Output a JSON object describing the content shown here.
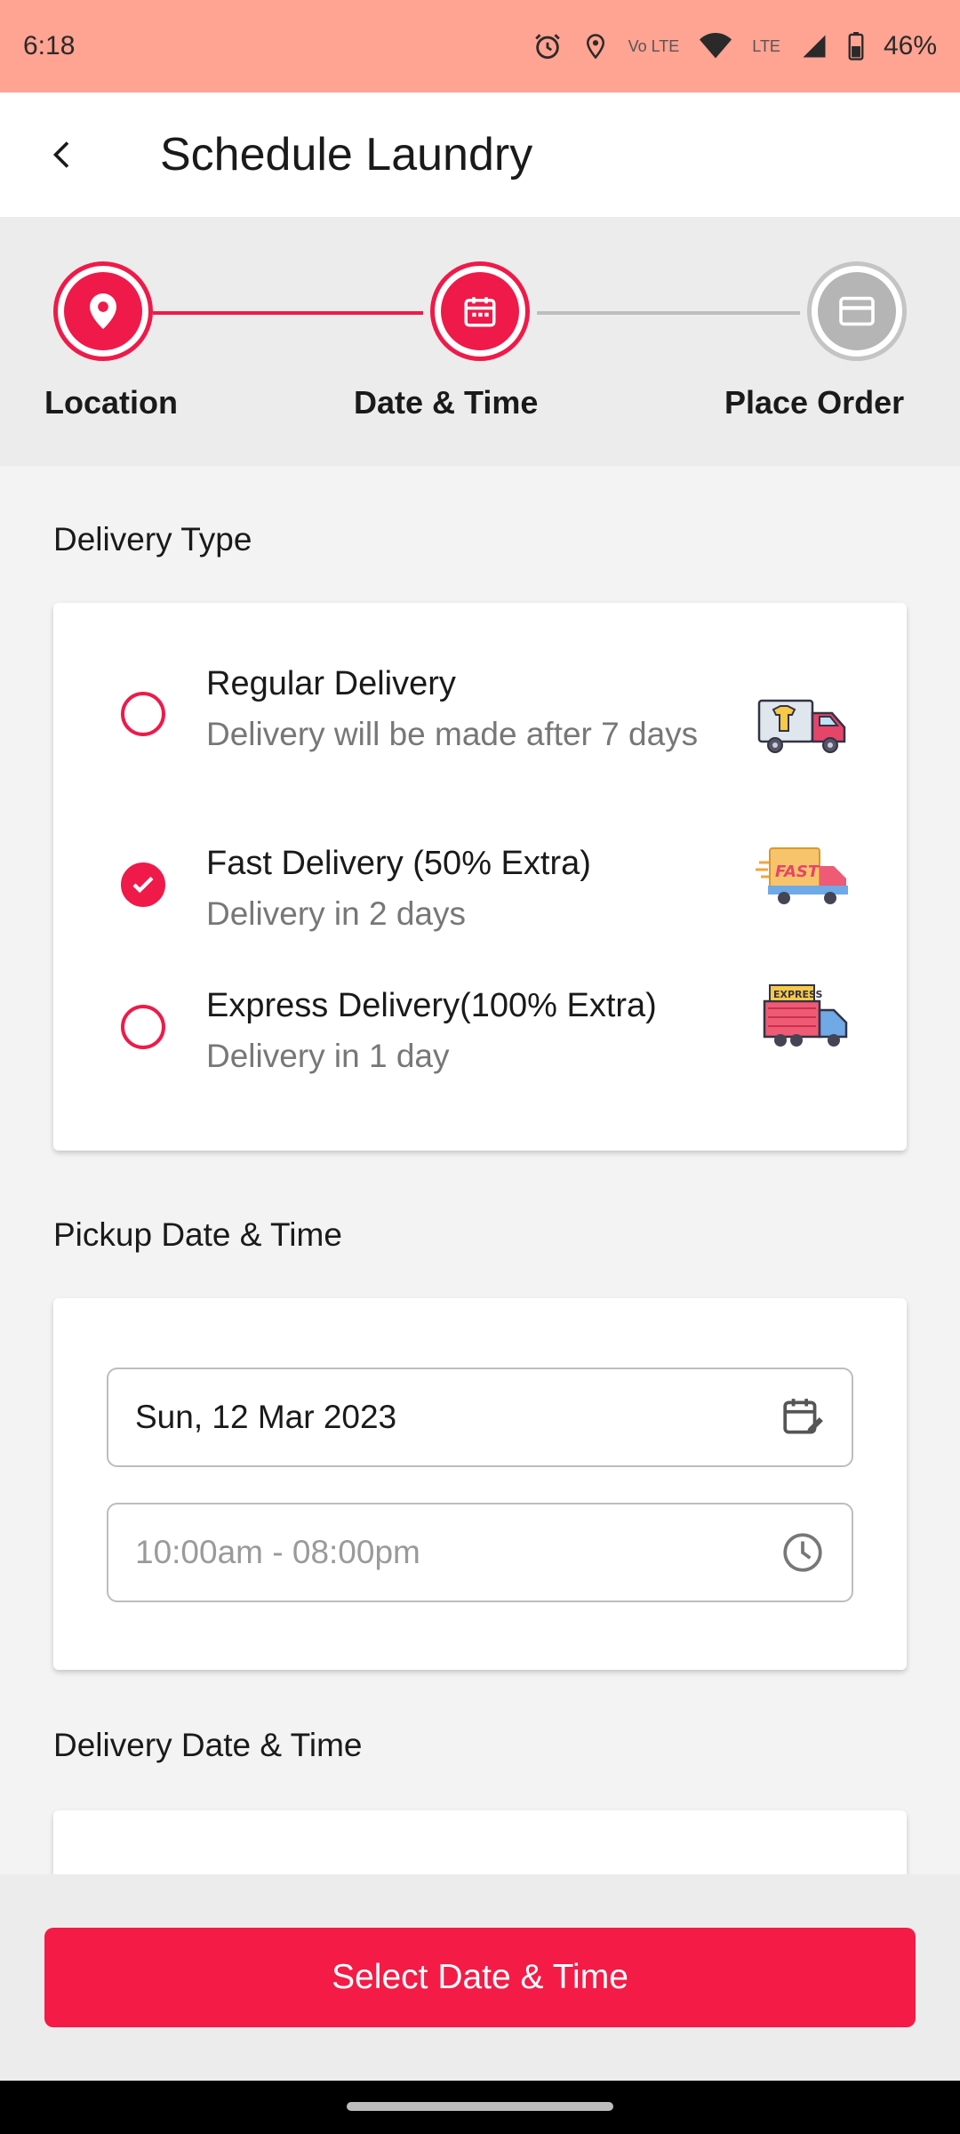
{
  "status_bar": {
    "time": "6:18",
    "battery": "46%",
    "network": "LTE",
    "volte": "Vo LTE"
  },
  "app_bar": {
    "title": "Schedule Laundry"
  },
  "stepper": {
    "steps": [
      {
        "label": "Location",
        "state": "complete",
        "icon": "location-pin-icon"
      },
      {
        "label": "Date & Time",
        "state": "active",
        "icon": "calendar-icon"
      },
      {
        "label": "Place Order",
        "state": "inactive",
        "icon": "card-icon"
      }
    ]
  },
  "delivery_type": {
    "title": "Delivery Type",
    "options": [
      {
        "title": "Regular Delivery",
        "subtitle": "Delivery will be made after 7 days",
        "selected": false,
        "icon": "laundry-truck-icon"
      },
      {
        "title": "Fast Delivery (50% Extra)",
        "subtitle": "Delivery in 2 days",
        "selected": true,
        "icon": "fast-truck-icon"
      },
      {
        "title": "Express Delivery(100% Extra)",
        "subtitle": "Delivery in 1 day",
        "selected": false,
        "icon": "express-truck-icon"
      }
    ]
  },
  "pickup": {
    "title": "Pickup Date & Time",
    "date_value": "Sun, 12 Mar 2023",
    "time_placeholder": "10:00am - 08:00pm"
  },
  "delivery": {
    "title": "Delivery Date & Time"
  },
  "cta": {
    "label": "Select Date & Time"
  },
  "colors": {
    "accent": "#ef1a49",
    "status_bar": "#ffa392",
    "inactive": "#b5b5b5"
  }
}
